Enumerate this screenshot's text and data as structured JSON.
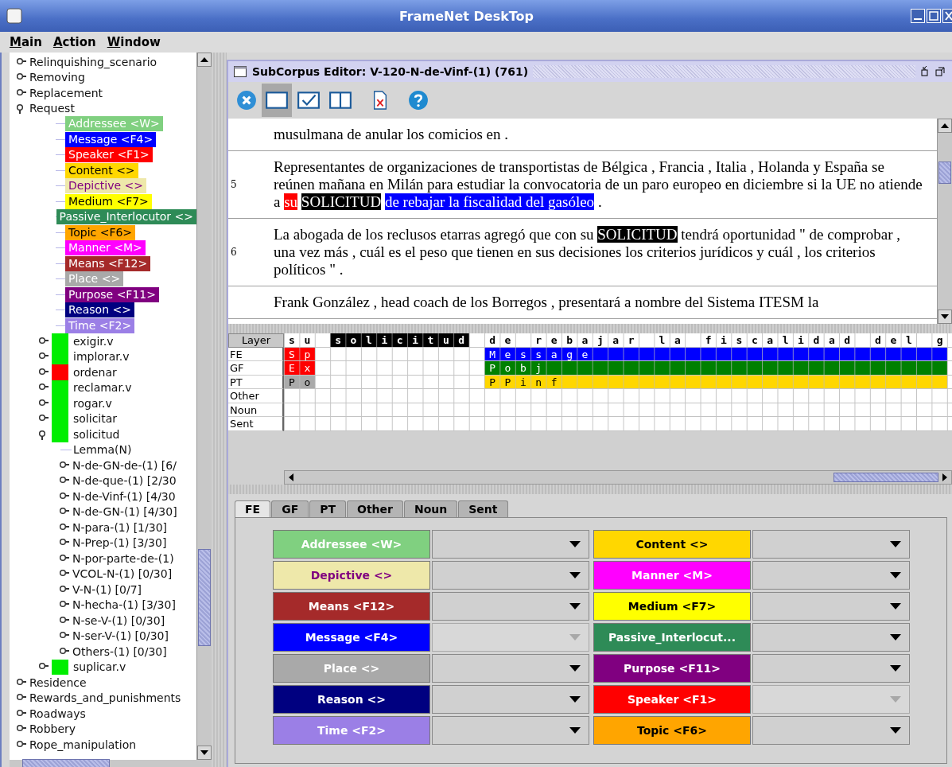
{
  "window": {
    "title": "FrameNet DeskTop"
  },
  "menu": [
    {
      "label": "Main"
    },
    {
      "label": "Action"
    },
    {
      "label": "Window"
    }
  ],
  "frame_tree": [
    {
      "label": "Relinquishing_scenario",
      "kind": "frame",
      "expanded": false
    },
    {
      "label": "Removing",
      "kind": "frame",
      "expanded": false
    },
    {
      "label": "Replacement",
      "kind": "frame",
      "expanded": false
    },
    {
      "label": "Request",
      "kind": "frame",
      "expanded": true,
      "children": [
        {
          "label": "Addressee <W>",
          "kind": "fe",
          "color": "#80d080"
        },
        {
          "label": "Message <F4>",
          "kind": "fe",
          "color": "#0000ff"
        },
        {
          "label": "Speaker <F1>",
          "kind": "fe",
          "color": "#ff0000"
        },
        {
          "label": "Content <>",
          "kind": "fe",
          "color": "#ffd700"
        },
        {
          "label": "Depictive <>",
          "kind": "fe",
          "color": "#eee8aa"
        },
        {
          "label": "Medium <F7>",
          "kind": "fe",
          "color": "#ffff00"
        },
        {
          "label": "Passive_Interlocutor <>",
          "kind": "fe",
          "color": "#2e8b57"
        },
        {
          "label": "Topic <F6>",
          "kind": "fe",
          "color": "#ffa500"
        },
        {
          "label": "Manner <M>",
          "kind": "fe",
          "color": "#ff00ff"
        },
        {
          "label": "Means <F12>",
          "kind": "fe",
          "color": "#a52a2a"
        },
        {
          "label": "Place <>",
          "kind": "fe",
          "color": "#a9a9a9"
        },
        {
          "label": "Purpose <F11>",
          "kind": "fe",
          "color": "#800080"
        },
        {
          "label": "Reason <>",
          "kind": "fe",
          "color": "#000080"
        },
        {
          "label": "Time <F2>",
          "kind": "fe",
          "color": "#9b7fe6"
        },
        {
          "label": "exigir.v",
          "kind": "lu",
          "color": "#00ee00",
          "expanded": false
        },
        {
          "label": "implorar.v",
          "kind": "lu",
          "color": "#00ee00",
          "expanded": false
        },
        {
          "label": "ordenar",
          "kind": "lu",
          "color": "#ff0000",
          "expanded": false
        },
        {
          "label": "reclamar.v",
          "kind": "lu",
          "color": "#00ee00",
          "expanded": false
        },
        {
          "label": "rogar.v",
          "kind": "lu",
          "color": "#00ee00",
          "expanded": false
        },
        {
          "label": "solicitar",
          "kind": "lu",
          "color": "#00ee00",
          "expanded": false
        },
        {
          "label": "solicitud",
          "kind": "lu",
          "color": "#00ee00",
          "expanded": true,
          "children": [
            {
              "label": "Lemma(N)",
              "kind": "lemma"
            },
            {
              "label": "N-de-GN-de-(1) [6/",
              "kind": "pattern",
              "expanded": false
            },
            {
              "label": "N-de-que-(1) [2/30",
              "kind": "pattern",
              "expanded": false
            },
            {
              "label": "N-de-Vinf-(1) [4/30",
              "kind": "pattern",
              "expanded": false
            },
            {
              "label": "N-de-GN-(1) [4/30]",
              "kind": "pattern",
              "expanded": false
            },
            {
              "label": "N-para-(1) [1/30]",
              "kind": "pattern",
              "expanded": false
            },
            {
              "label": "N-Prep-(1) [3/30]",
              "kind": "pattern",
              "expanded": false
            },
            {
              "label": "N-por-parte-de-(1)",
              "kind": "pattern",
              "expanded": false
            },
            {
              "label": "VCOL-N-(1) [0/30]",
              "kind": "pattern",
              "expanded": false
            },
            {
              "label": "V-N-(1) [0/7]",
              "kind": "pattern",
              "expanded": false
            },
            {
              "label": "N-hecha-(1) [3/30]",
              "kind": "pattern",
              "expanded": false
            },
            {
              "label": "N-se-V-(1) [0/30]",
              "kind": "pattern",
              "expanded": false
            },
            {
              "label": "N-ser-V-(1) [0/30]",
              "kind": "pattern",
              "expanded": false
            },
            {
              "label": "Others-(1) [0/30]",
              "kind": "pattern",
              "expanded": false
            }
          ]
        },
        {
          "label": "suplicar.v",
          "kind": "lu",
          "color": "#00ee00",
          "expanded": false
        }
      ]
    },
    {
      "label": "Residence",
      "kind": "frame",
      "expanded": false
    },
    {
      "label": "Rewards_and_punishments",
      "kind": "frame",
      "expanded": false
    },
    {
      "label": "Roadways",
      "kind": "frame",
      "expanded": false
    },
    {
      "label": "Robbery",
      "kind": "frame",
      "expanded": false
    },
    {
      "label": "Rope_manipulation",
      "kind": "frame",
      "expanded": false
    }
  ],
  "editor": {
    "title": "SubCorpus Editor: V-120-N-de-Vinf-(1) (761)",
    "toolbar": [
      {
        "kind": "close"
      },
      {
        "kind": "single",
        "selected": true
      },
      {
        "kind": "check",
        "selected": false
      },
      {
        "kind": "split",
        "selected": false
      },
      {
        "kind": "delete"
      },
      {
        "kind": "help"
      }
    ],
    "sentences": [
      {
        "segments": [
          {
            "kind": "text",
            "text": "musulmana de anular los comicios en ."
          }
        ]
      },
      {
        "number": "5",
        "segments": [
          {
            "kind": "text",
            "text": "Representantes de organizaciones de transportistas de Bélgica , Francia , Italia , Holanda y España se reúnen mañana en Milán para estudiar la convocatoria de un paro europeo en diciembre si la UE no atiende a"
          },
          {
            "kind": "fe",
            "text": "su",
            "color": "#ff0000"
          },
          {
            "kind": "target",
            "text": "SOLICITUD"
          },
          {
            "kind": "fe",
            "text": "de rebajar la fiscalidad del gasóleo",
            "color": "#0000ff"
          },
          {
            "kind": "text",
            "text": "."
          }
        ]
      },
      {
        "number": "6",
        "segments": [
          {
            "kind": "text",
            "text": "La abogada de los reclusos etarras agregó que con su"
          },
          {
            "kind": "target",
            "text": "SOLICITUD"
          },
          {
            "kind": "text",
            "text": "tendrá oportunidad \" de comprobar , una vez más , cuál es el peso que tienen en sus decisiones los criterios jurídicos y cuál , los criterios políticos \" ."
          }
        ]
      },
      {
        "segments": [
          {
            "kind": "text",
            "text": "Frank González , head coach de los Borregos , presentará a nombre del Sistema ITESM la"
          }
        ]
      }
    ],
    "annotation": {
      "layer_header": "Layer",
      "layers": [
        {
          "name": "FE"
        },
        {
          "name": "GF"
        },
        {
          "name": "PT"
        },
        {
          "name": "Other"
        },
        {
          "name": "Noun"
        },
        {
          "name": "Sent"
        }
      ],
      "groups": [
        {
          "text": "su",
          "target": false,
          "labels": [
            {
              "text": "Sp",
              "color": "#ff0000"
            },
            {
              "text": "Ex",
              "color": "#ff0000"
            },
            {
              "text": "Po",
              "color": "#aaaaaa"
            }
          ]
        },
        {
          "text": "solicitud",
          "target": true
        },
        {
          "text": "de rebajar la fiscalidad del g",
          "target": false,
          "labels": [
            {
              "text": "Message",
              "color": "#0000ff"
            },
            {
              "text": "Pobj",
              "color": "#008000"
            },
            {
              "text": "PPinf",
              "color": "#ffd700"
            }
          ]
        }
      ]
    },
    "tabs": [
      {
        "label": "FE",
        "selected": true
      },
      {
        "label": "GF",
        "selected": false
      },
      {
        "label": "PT",
        "selected": false
      },
      {
        "label": "Other",
        "selected": false
      },
      {
        "label": "Noun",
        "selected": false
      },
      {
        "label": "Sent",
        "selected": false
      }
    ],
    "fe_buttons": [
      {
        "label": "Addressee <W>",
        "color": "#80d080",
        "disabled": false
      },
      {
        "label": "Depictive <>",
        "color": "#eee8aa",
        "disabled": false
      },
      {
        "label": "Means <F12>",
        "color": "#a52a2a",
        "disabled": false
      },
      {
        "label": "Message <F4>",
        "color": "#0000ff",
        "disabled": true
      },
      {
        "label": "Place <>",
        "color": "#a9a9a9",
        "disabled": false
      },
      {
        "label": "Reason <>",
        "color": "#000080",
        "disabled": false
      },
      {
        "label": "Time <F2>",
        "color": "#9b7fe6",
        "disabled": false
      },
      {
        "label": "Content <>",
        "color": "#ffd700",
        "disabled": false
      },
      {
        "label": "Manner <M>",
        "color": "#ff00ff",
        "disabled": false
      },
      {
        "label": "Medium <F7>",
        "color": "#ffff00",
        "disabled": false
      },
      {
        "label": "Passive_Interlocut...",
        "color": "#2e8b57",
        "disabled": false
      },
      {
        "label": "Purpose <F11>",
        "color": "#800080",
        "disabled": false
      },
      {
        "label": "Speaker <F1>",
        "color": "#ff0000",
        "disabled": true
      },
      {
        "label": "Topic <F6>",
        "color": "#ffa500",
        "disabled": false
      }
    ]
  }
}
